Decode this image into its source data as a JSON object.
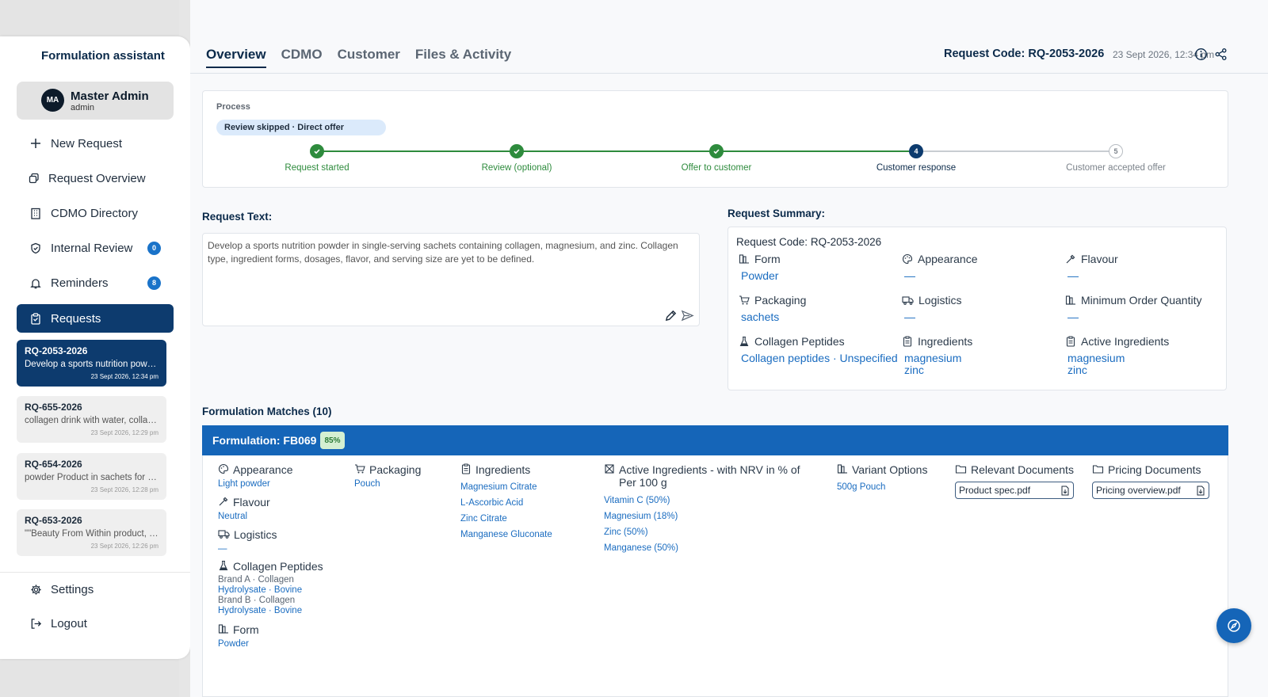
{
  "app": {
    "brand": "Formulation assistant",
    "user": {
      "initials": "MA",
      "name": "Master Admin",
      "role": "admin"
    }
  },
  "sidebar": {
    "nav": [
      {
        "label": "New Request",
        "icon": "plus-icon"
      },
      {
        "label": "Request Overview",
        "icon": "copy-icon"
      },
      {
        "label": "CDMO Directory",
        "icon": "building-icon"
      },
      {
        "label": "Internal Review",
        "icon": "shield-icon",
        "badge": "0"
      },
      {
        "label": "Reminders",
        "icon": "bell-icon",
        "badge": "8"
      },
      {
        "label": "Requests",
        "icon": "clipboard-icon",
        "active": true
      }
    ],
    "requests": [
      {
        "code": "RQ-2053-2026",
        "desc": "Develop a sports nutrition powder in single-serving sachets",
        "time": "23 Sept 2026, 12:34 pm",
        "selected": true
      },
      {
        "code": "RQ-655-2026",
        "desc": "collagen drink with water, collagen",
        "time": "23 Sept 2026, 12:29 pm"
      },
      {
        "code": "RQ-654-2026",
        "desc": "powder Product in sachets for collagen",
        "time": "23 Sept 2026, 12:28 pm"
      },
      {
        "code": "RQ-653-2026",
        "desc": "\"\"Beauty From Within product, collagen",
        "time": "23 Sept 2026, 12:26 pm"
      }
    ],
    "footer": [
      {
        "label": "Settings",
        "icon": "gear-icon"
      },
      {
        "label": "Logout",
        "icon": "logout-icon"
      }
    ]
  },
  "header": {
    "tabs": [
      "Overview",
      "CDMO",
      "Customer",
      "Files & Activity"
    ],
    "active_tab": "Overview",
    "request_code_label": "Request Code:",
    "request_code": "RQ-2053-2026",
    "timestamp": "23 Sept 2026, 12:34 pm"
  },
  "process": {
    "label": "Process",
    "pill": "Review skipped · Direct offer",
    "steps": [
      {
        "label": "Request started",
        "state": "done"
      },
      {
        "label": "Review (optional)",
        "state": "done"
      },
      {
        "label": "Offer to customer",
        "state": "done"
      },
      {
        "label": "Customer response",
        "state": "current",
        "number": "4"
      },
      {
        "label": "Customer accepted offer",
        "state": "todo",
        "number": "5"
      }
    ]
  },
  "request_text": {
    "title": "Request Text:",
    "body": "Develop a sports nutrition powder in single-serving sachets containing collagen, magnesium, and zinc. Collagen type, ingredient forms, dosages, flavor, and serving size are yet to be defined."
  },
  "summary": {
    "title": "Request Summary:",
    "code_label": "Request Code:",
    "code": "RQ-2053-2026",
    "cells": [
      {
        "label": "Form",
        "icon": "form-icon",
        "values": [
          "Powder"
        ]
      },
      {
        "label": "Appearance",
        "icon": "palette-icon",
        "values": [
          "—"
        ]
      },
      {
        "label": "Flavour",
        "icon": "dropper-icon",
        "values": [
          "—"
        ]
      },
      {
        "label": "Packaging",
        "icon": "cart-icon",
        "values": [
          "sachets"
        ]
      },
      {
        "label": "Logistics",
        "icon": "truck-icon",
        "values": [
          "—"
        ]
      },
      {
        "label": "Minimum Order Quantity",
        "icon": "form-icon",
        "values": [
          "—"
        ]
      },
      {
        "label": "Collagen Peptides",
        "icon": "flask-icon",
        "values": [
          "Collagen peptides · Unspecified"
        ]
      },
      {
        "label": "Ingredients",
        "icon": "clipboard-icon",
        "values": [
          "magnesium",
          "zinc"
        ]
      },
      {
        "label": "Active Ingredients",
        "icon": "clipboard-icon",
        "values": [
          "magnesium",
          "zinc"
        ]
      }
    ]
  },
  "matches": {
    "title": "Formulation Matches (10)",
    "formulation_label": "Formulation: FB069",
    "score": "85%",
    "appearance": {
      "label": "Appearance",
      "value": "Light powder"
    },
    "flavour": {
      "label": "Flavour",
      "value": "Neutral"
    },
    "logistics": {
      "label": "Logistics",
      "value": "—"
    },
    "collagen": {
      "label": "Collagen Peptides",
      "values": [
        "Brand A · Collagen",
        "Hydrolysate · Bovine",
        "Brand B · Collagen",
        "Hydrolysate · Bovine"
      ]
    },
    "form": {
      "label": "Form",
      "value": "Powder"
    },
    "packaging": {
      "label": "Packaging",
      "value": "Pouch"
    },
    "ingredients": {
      "label": "Ingredients",
      "values": [
        "Magnesium Citrate",
        "L-Ascorbic Acid",
        "Zinc Citrate",
        "Manganese Gluconate"
      ]
    },
    "active": {
      "label": "Active Ingredients - with NRV in % of Per 100 g",
      "values": [
        "Vitamin C  (50%)",
        "Magnesium  (18%)",
        "Zinc  (50%)",
        "Manganese  (50%)"
      ]
    },
    "variants": {
      "label": "Variant Options",
      "value": "500g Pouch"
    },
    "relevant_docs": {
      "label": "Relevant Documents",
      "file": "Product spec.pdf"
    },
    "pricing_docs": {
      "label": "Pricing Documents",
      "file": "Pricing overview.pdf"
    }
  },
  "colors": {
    "primary": "#0d3b6e",
    "accent": "#1565b8",
    "link": "#1a6cc0",
    "success": "#2e8b3d"
  }
}
